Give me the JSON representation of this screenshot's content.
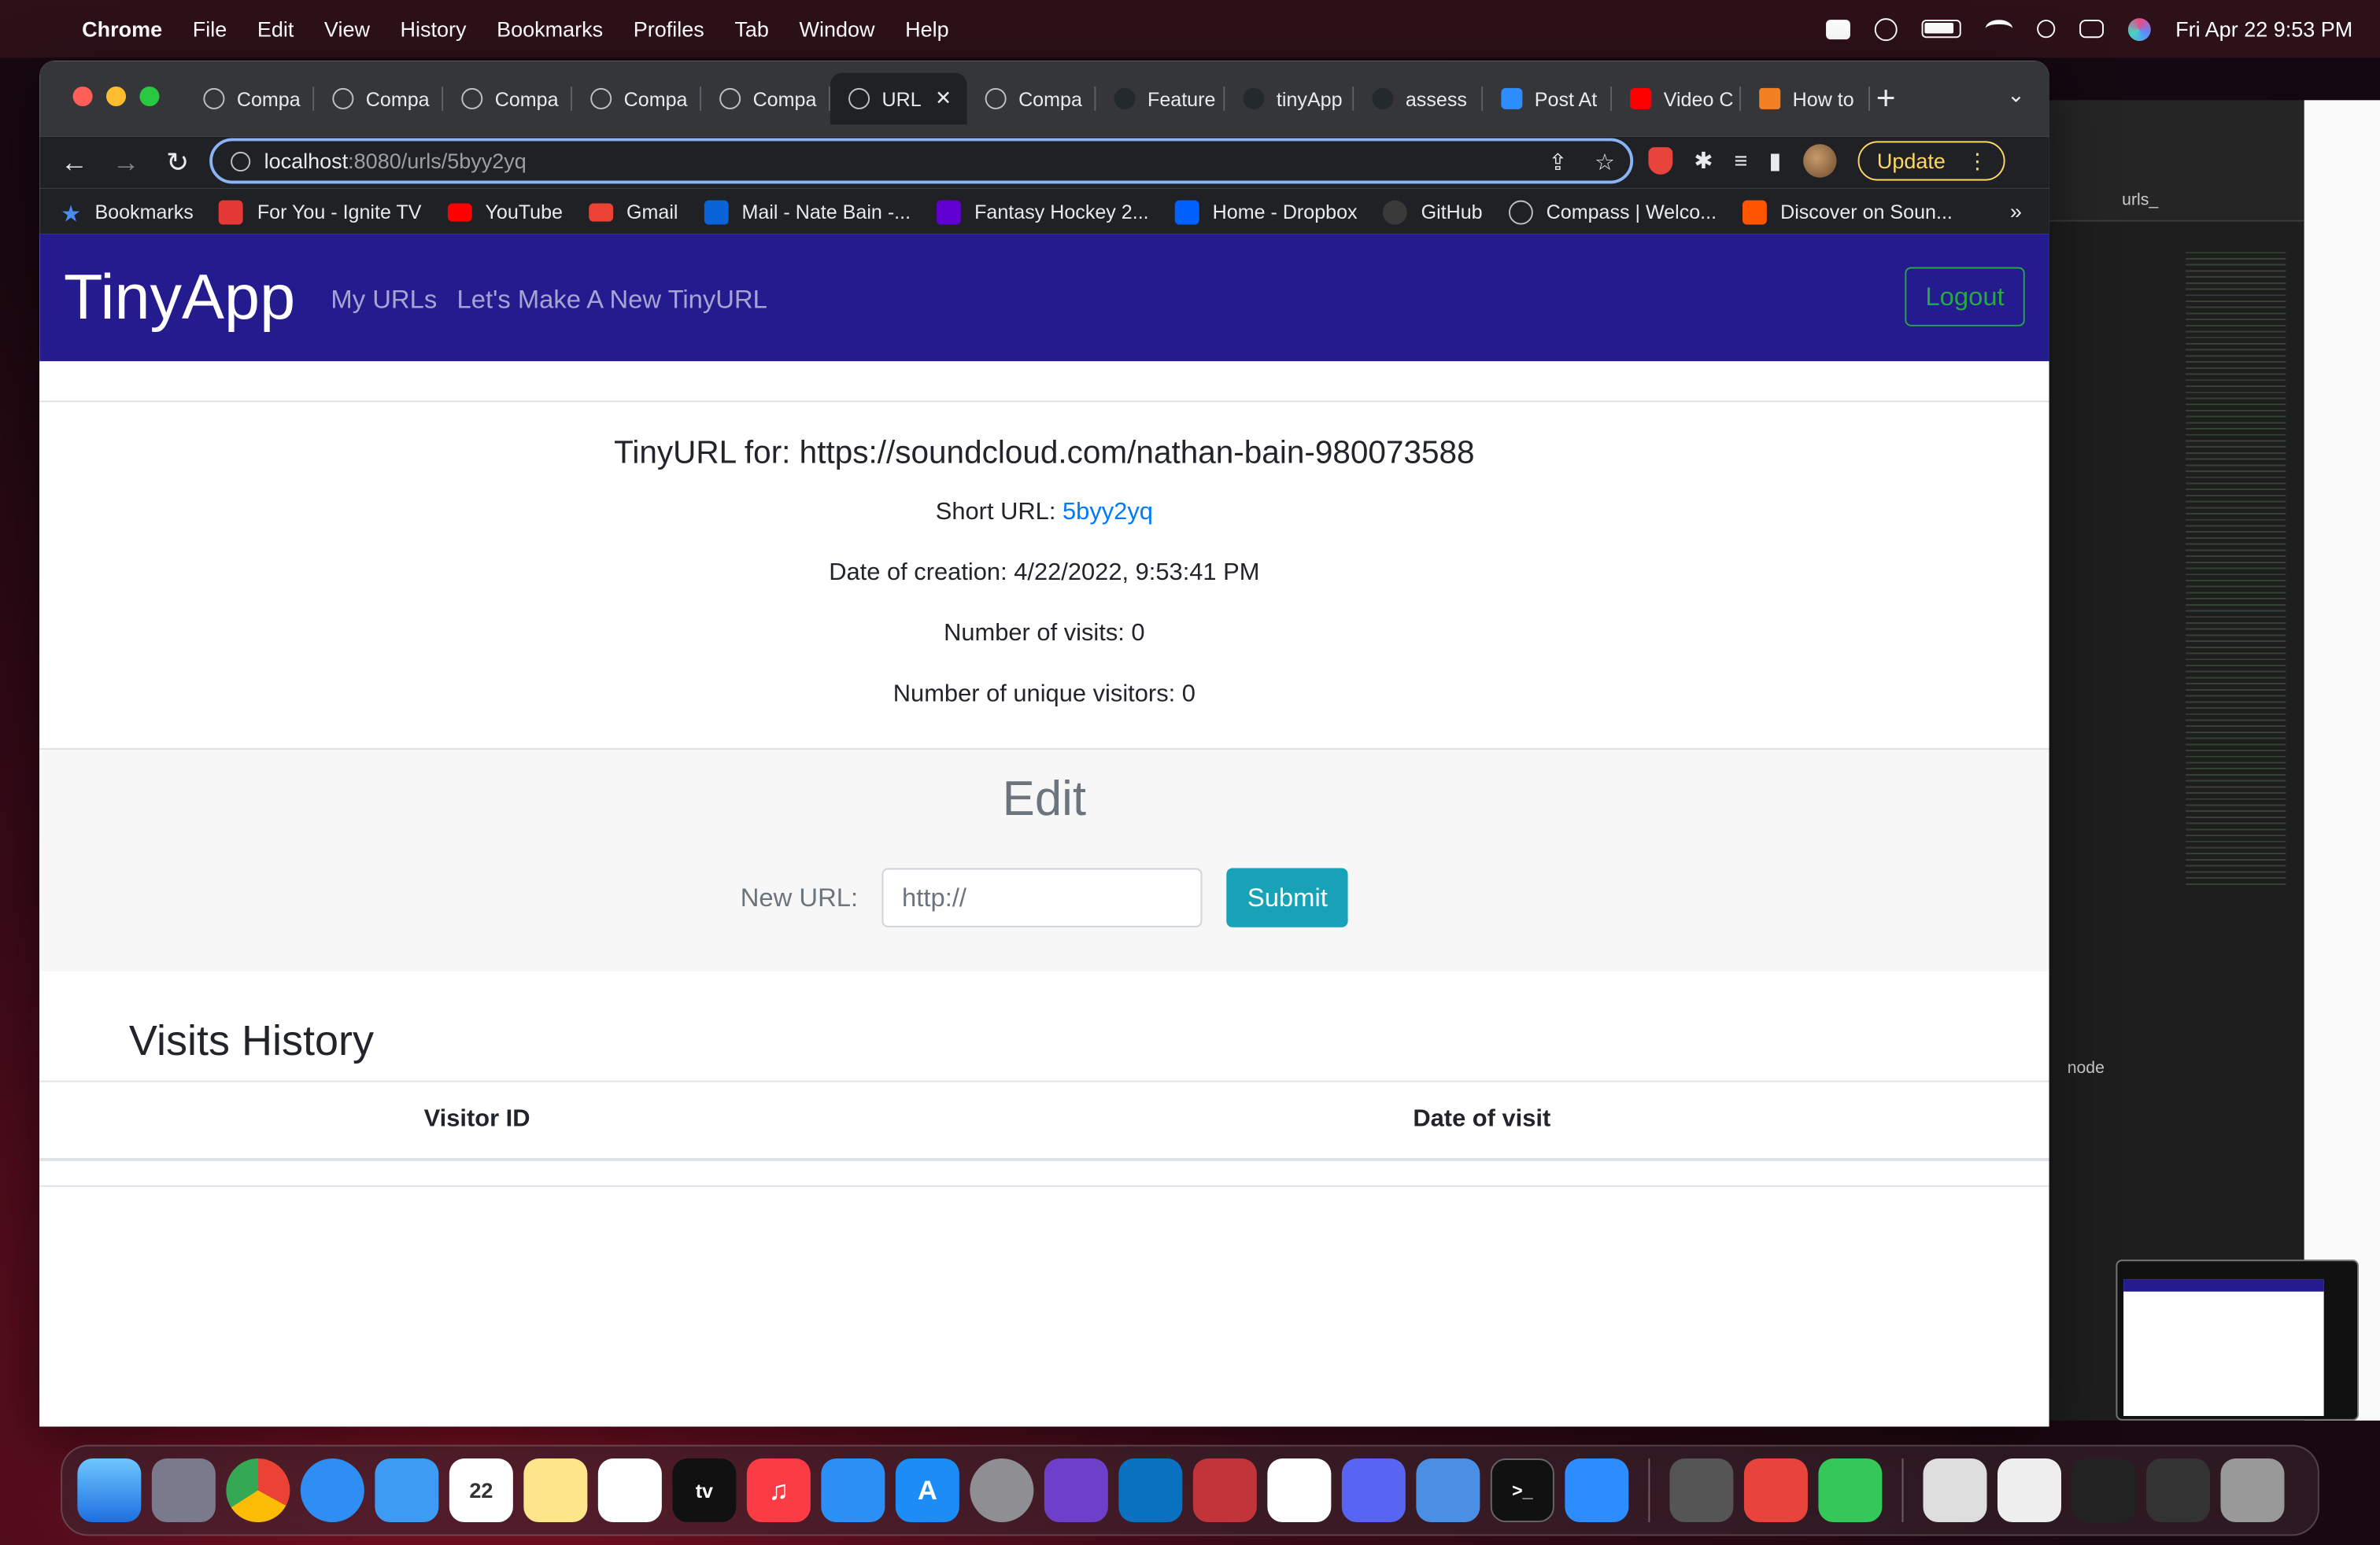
{
  "menubar": {
    "app": "Chrome",
    "items": [
      "File",
      "Edit",
      "View",
      "History",
      "Bookmarks",
      "Profiles",
      "Tab",
      "Window",
      "Help"
    ],
    "datetime": "Fri Apr 22  9:53 PM"
  },
  "browser": {
    "tabs": [
      {
        "label": "Compa",
        "icon": "globe-icon"
      },
      {
        "label": "Compa",
        "icon": "globe-icon"
      },
      {
        "label": "Compa",
        "icon": "globe-icon"
      },
      {
        "label": "Compa",
        "icon": "globe-icon"
      },
      {
        "label": "Compa",
        "icon": "globe-icon"
      },
      {
        "label": "URL",
        "icon": "globe-icon",
        "active": true
      },
      {
        "label": "Compa",
        "icon": "globe-icon"
      },
      {
        "label": "Feature",
        "icon": "github-icon"
      },
      {
        "label": "tinyApp",
        "icon": "github-icon"
      },
      {
        "label": "assess",
        "icon": "github-icon"
      },
      {
        "label": "Post At",
        "icon": "zoom-icon"
      },
      {
        "label": "Video C",
        "icon": "youtube-icon"
      },
      {
        "label": "How to",
        "icon": "stackoverflow-icon"
      }
    ],
    "url_host": "localhost",
    "url_path": ":8080/urls/5byy2yq",
    "update_label": "Update",
    "bookmarks": [
      {
        "label": "Bookmarks",
        "color": "#4c8bf5"
      },
      {
        "label": "For You - Ignite TV",
        "color": "#e53935"
      },
      {
        "label": "YouTube",
        "color": "#ff0000"
      },
      {
        "label": "Gmail",
        "color": "#ea4335"
      },
      {
        "label": "Mail - Nate Bain -...",
        "color": "#0a64d8"
      },
      {
        "label": "Fantasy Hockey 2...",
        "color": "#6001d2"
      },
      {
        "label": "Home - Dropbox",
        "color": "#0061ff"
      },
      {
        "label": "GitHub",
        "color": "#24292e"
      },
      {
        "label": "Compass | Welco...",
        "color": "#444444"
      },
      {
        "label": "Discover on Soun...",
        "color": "#ff5500"
      }
    ],
    "bookmarks_more": "»"
  },
  "page": {
    "brand": "TinyApp",
    "nav": {
      "my_urls": "My URLs",
      "new_url": "Let's Make A New TinyURL",
      "logout": "Logout"
    },
    "card": {
      "title": "TinyURL for: https://soundcloud.com/nathan-bain-980073588",
      "short_label": "Short URL:",
      "short_value": "5byy2yq",
      "created": "Date of creation: 4/22/2022, 9:53:41 PM",
      "visits": "Number of visits: 0",
      "unique": "Number of unique visitors: 0"
    },
    "edit": {
      "heading": "Edit",
      "label": "New URL:",
      "placeholder": "http://",
      "submit": "Submit"
    },
    "history": {
      "heading": "Visits History",
      "col1": "Visitor ID",
      "col2": "Date of visit"
    }
  },
  "side": {
    "terminal_label": "node",
    "tab_label": "urls_"
  },
  "colors": {
    "navbar": "#231b8e",
    "logout": "#28a745",
    "submit": "#17a2b8",
    "link": "#007bff"
  }
}
